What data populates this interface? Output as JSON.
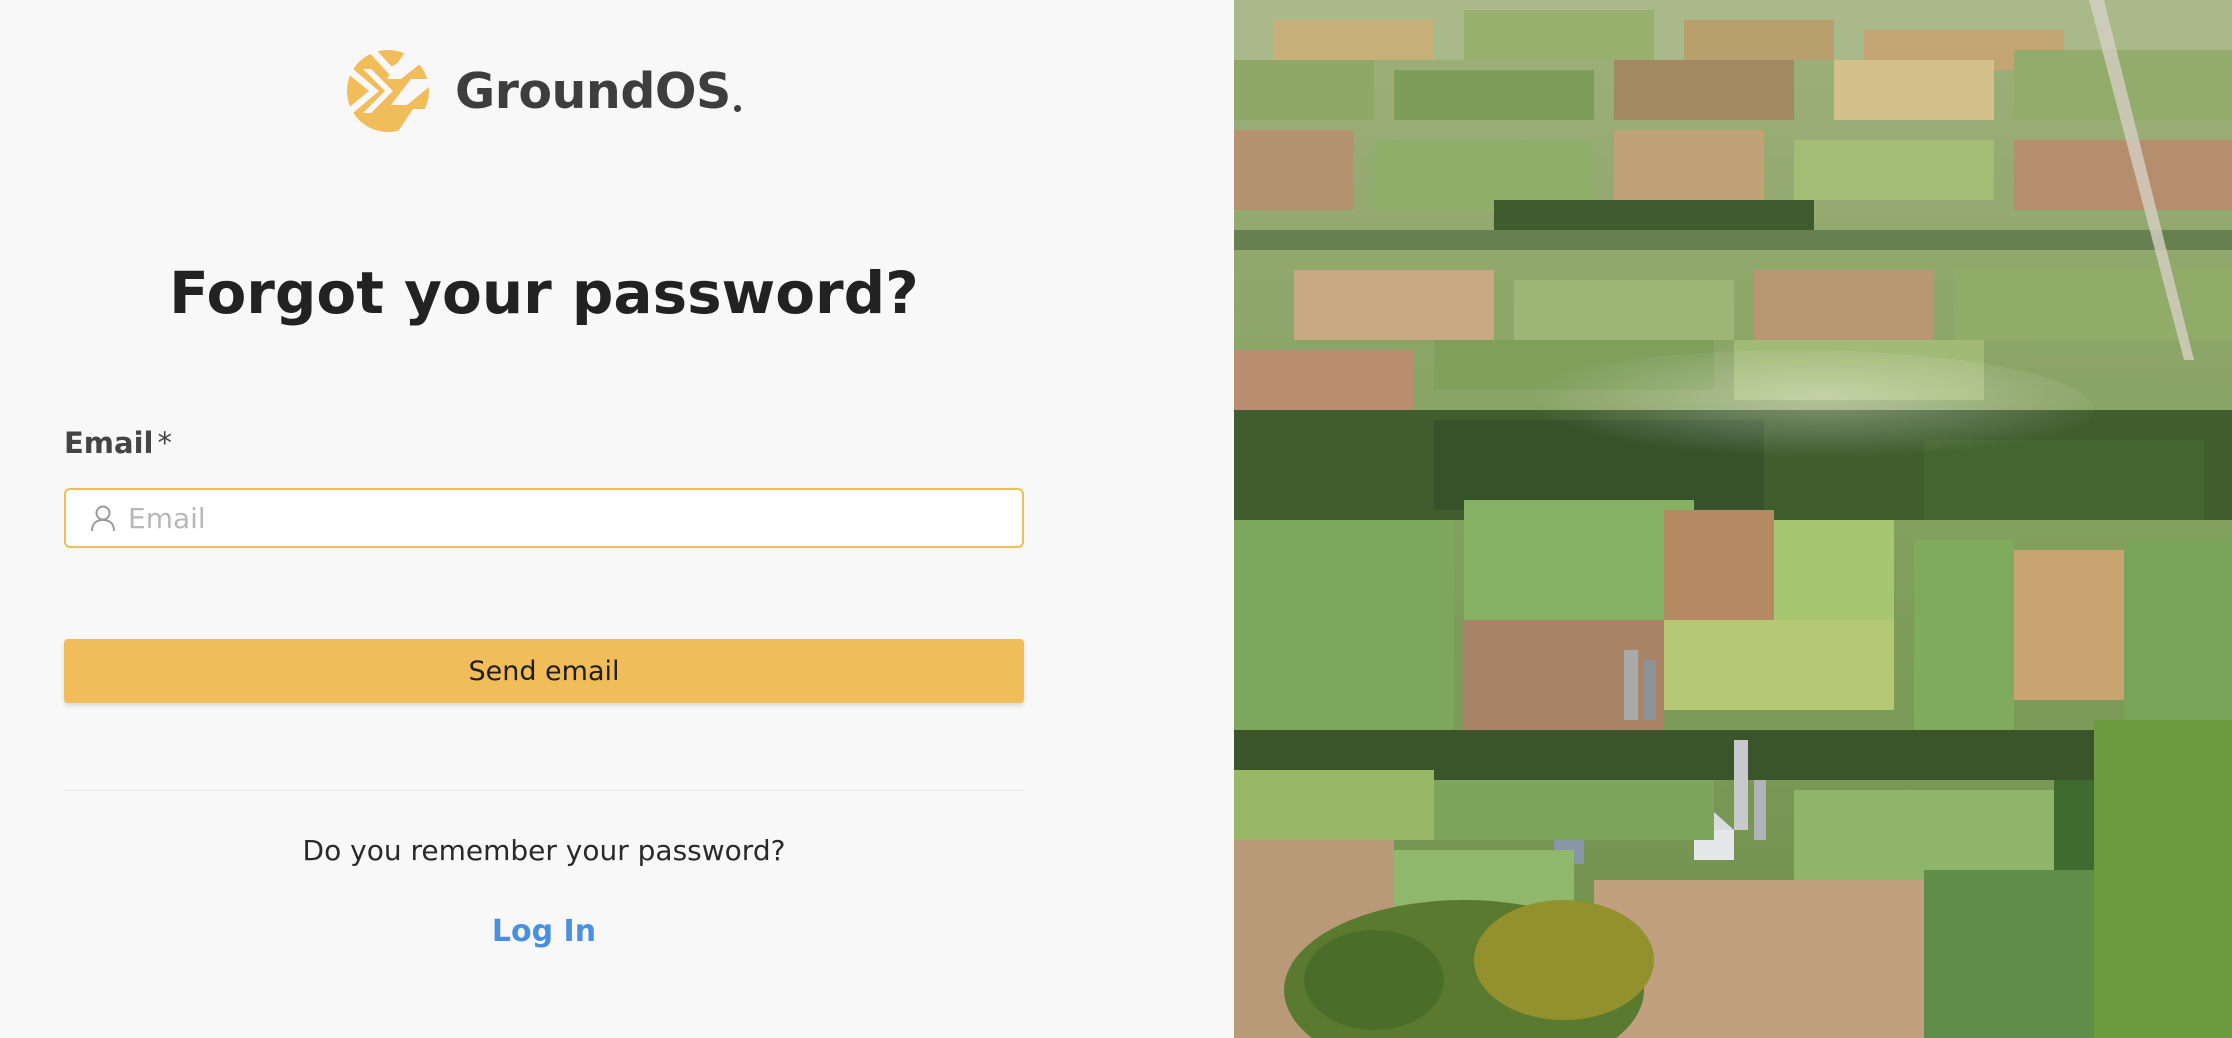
{
  "brand": {
    "name": "GroundOS",
    "logo_icon": "chevron-arrows-icon",
    "accent_color": "#f1bc5a",
    "text_color": "#3e3e3e"
  },
  "form": {
    "title": "Forgot your password?",
    "email_label": "Email",
    "required_marker": "*",
    "email_placeholder": "Email",
    "email_value": "",
    "email_icon": "user-icon",
    "submit_label": "Send email"
  },
  "footer": {
    "remember_text": "Do you remember your password?",
    "login_link": "Log In",
    "link_color": "#4a90e2"
  },
  "background": {
    "image": "aerial-farmland-photo"
  }
}
